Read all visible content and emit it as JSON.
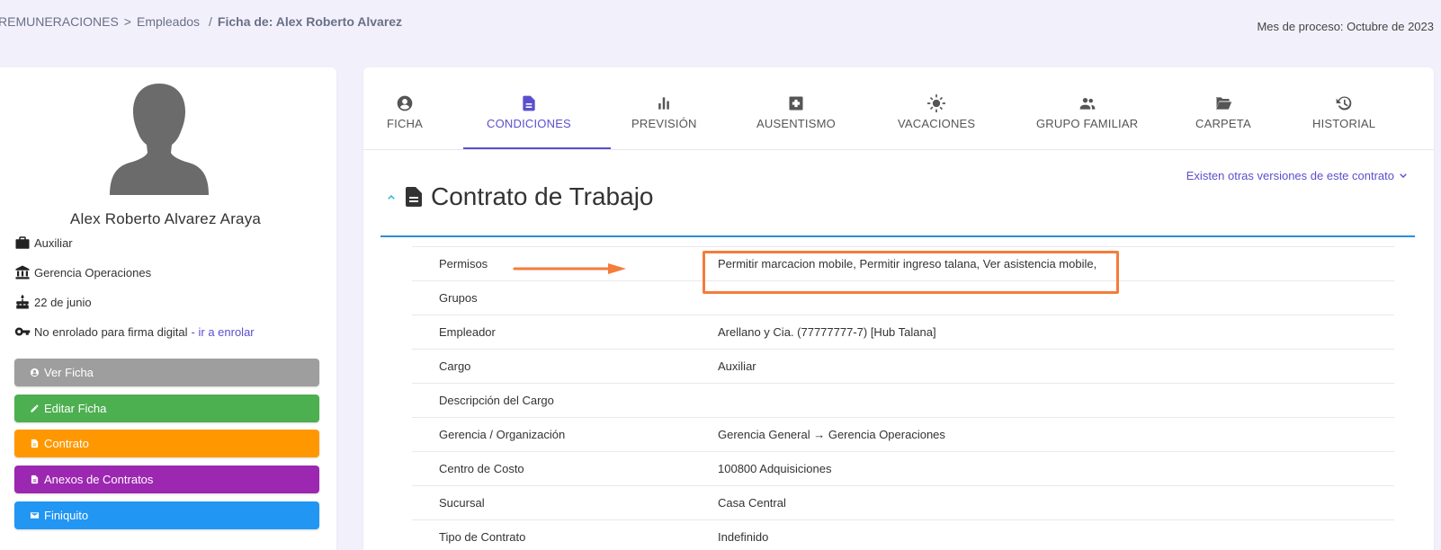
{
  "breadcrumb": {
    "root": "REMUNERACIONES",
    "sep1": ">",
    "section": "Empleados",
    "sep2": "/",
    "current": "Ficha de: Alex Roberto Alvarez"
  },
  "process_month": "Mes de proceso: Octubre de 2023",
  "employee": {
    "name": "Alex Roberto Alvarez Araya",
    "position": "Auxiliar",
    "department": "Gerencia Operaciones",
    "birthday": "22 de junio",
    "signature_status": "No enrolado para firma digital",
    "enroll_link": "- ir a enrolar"
  },
  "actions": [
    {
      "label": "Ver Ficha",
      "icon": "user-circle-icon",
      "color": "#9e9e9e"
    },
    {
      "label": "Editar Ficha",
      "icon": "pencil-icon",
      "color": "#4caf50"
    },
    {
      "label": "Contrato",
      "icon": "document-icon",
      "color": "#ff9800"
    },
    {
      "label": "Anexos de Contratos",
      "icon": "document-icon",
      "color": "#9c27b0"
    },
    {
      "label": "Finiquito",
      "icon": "envelope-icon",
      "color": "#2196f3"
    }
  ],
  "tabs": [
    {
      "label": "FICHA",
      "icon": "user-circle-icon"
    },
    {
      "label": "CONDICIONES",
      "icon": "document-icon",
      "active": true
    },
    {
      "label": "PREVISIÓN",
      "icon": "bar-chart-icon"
    },
    {
      "label": "AUSENTISMO",
      "icon": "medical-cross-icon"
    },
    {
      "label": "VACACIONES",
      "icon": "sun-icon"
    },
    {
      "label": "GRUPO FAMILIAR",
      "icon": "people-icon"
    },
    {
      "label": "CARPETA",
      "icon": "folder-open-icon"
    },
    {
      "label": "HISTORIAL",
      "icon": "history-icon"
    }
  ],
  "other_versions": "Existen otras versiones de este contrato",
  "section_title": "Contrato de Trabajo",
  "rows": [
    {
      "label": "Permisos",
      "value": "Permitir marcacion mobile, Permitir ingreso talana, Ver asistencia mobile,"
    },
    {
      "label": "Grupos",
      "value": ""
    },
    {
      "label": "Empleador",
      "value": "Arellano y Cia. (77777777-7) [Hub Talana]"
    },
    {
      "label": "Cargo",
      "value": "Auxiliar"
    },
    {
      "label": "Descripción del Cargo",
      "value": ""
    },
    {
      "label": "Gerencia / Organización",
      "value": "Gerencia General → Gerencia Operaciones"
    },
    {
      "label": "Centro de Costo",
      "value": "100800 Adquisiciones"
    },
    {
      "label": "Sucursal",
      "value": "Casa Central"
    },
    {
      "label": "Tipo de Contrato",
      "value": "Indefinido"
    }
  ],
  "colors": {
    "accent": "#5b4fcf",
    "highlight": "#f57c3a",
    "section_rule": "#2d8fd6"
  }
}
